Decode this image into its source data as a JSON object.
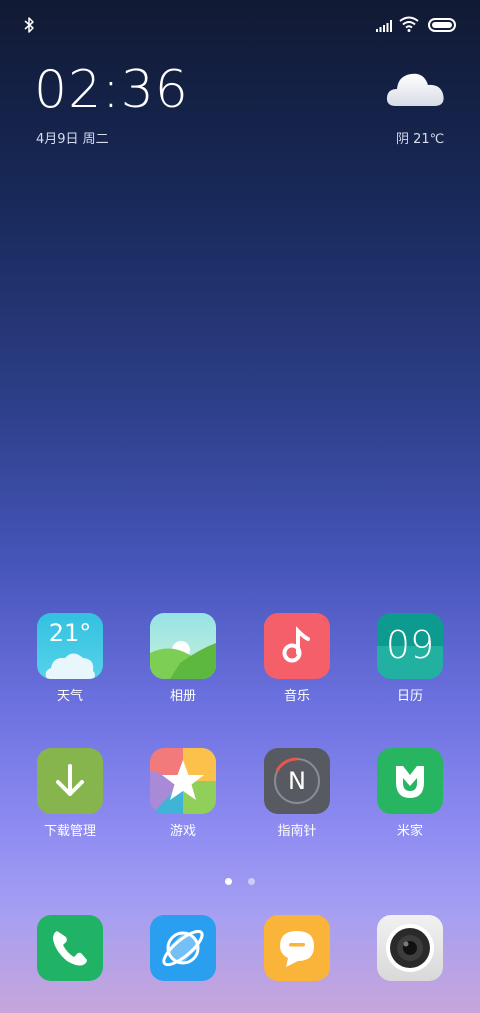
{
  "status_bar": {
    "bluetooth": "bluetooth-icon",
    "signal": "signal-icon",
    "wifi": "wifi-icon",
    "battery": "battery-icon"
  },
  "clock": {
    "time": "02:36",
    "date": "4月9日 周二"
  },
  "weather": {
    "condition_icon": "cloud-icon",
    "text": "阴 21℃"
  },
  "apps_row1": [
    {
      "label": "天气",
      "icon_text": "21°",
      "icon": "weather-app-icon"
    },
    {
      "label": "相册",
      "icon": "gallery-app-icon"
    },
    {
      "label": "音乐",
      "icon": "music-app-icon"
    },
    {
      "label": "日历",
      "icon_text": "09",
      "icon": "calendar-app-icon"
    }
  ],
  "apps_row2": [
    {
      "label": "下载管理",
      "icon": "downloads-app-icon"
    },
    {
      "label": "游戏",
      "icon": "games-app-icon"
    },
    {
      "label": "指南针",
      "icon_text": "N",
      "icon": "compass-app-icon"
    },
    {
      "label": "米家",
      "icon": "mijia-app-icon"
    }
  ],
  "pages": {
    "count": 2,
    "active": 1
  },
  "dock": [
    {
      "icon": "phone-app-icon"
    },
    {
      "icon": "browser-app-icon"
    },
    {
      "icon": "messages-app-icon"
    },
    {
      "icon": "camera-app-icon"
    }
  ],
  "colors": {
    "weather": "#3ec7e0",
    "gallery": "#8bd16b",
    "music": "#f45f6a",
    "calendar": "#17a89a",
    "downloads": "#86b54e",
    "compass": "#585a62",
    "mijia": "#27b562",
    "phone": "#20b365",
    "browser": "#2a9ff0",
    "messages": "#fbb43a",
    "camera": "#e6e6e6"
  }
}
